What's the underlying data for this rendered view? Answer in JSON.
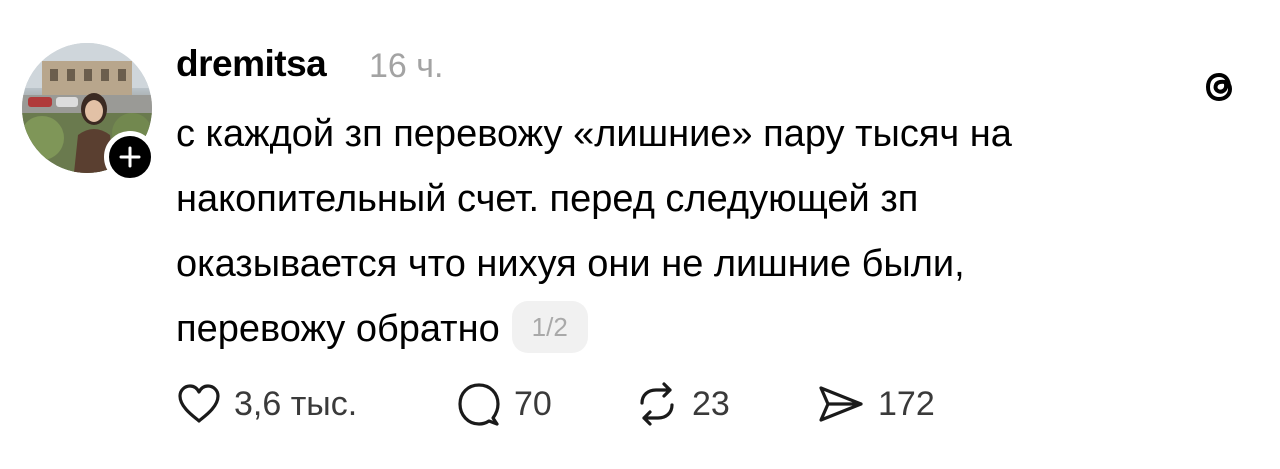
{
  "post": {
    "username": "dremitsa",
    "timestamp": "16 ч.",
    "text_lines": [
      "с каждой зп перевожу «лишние» пару тысяч на",
      "накопительный счет. перед следующей зп",
      "оказывается что нихуя они не лишние были,",
      "перевожу обратно"
    ],
    "page_indicator": "1/2"
  },
  "actions": {
    "likes": "3,6 тыс.",
    "replies": "70",
    "reposts": "23",
    "shares": "172"
  },
  "icons": {
    "app_logo": "threads-logo-icon",
    "follow": "plus-icon",
    "like": "heart-icon",
    "reply": "speech-bubble-icon",
    "repost": "repost-arrows-icon",
    "share": "paper-plane-icon"
  },
  "colors": {
    "text": "#000000",
    "muted": "#a3a3a3",
    "pill_bg": "#f1f1f1"
  }
}
